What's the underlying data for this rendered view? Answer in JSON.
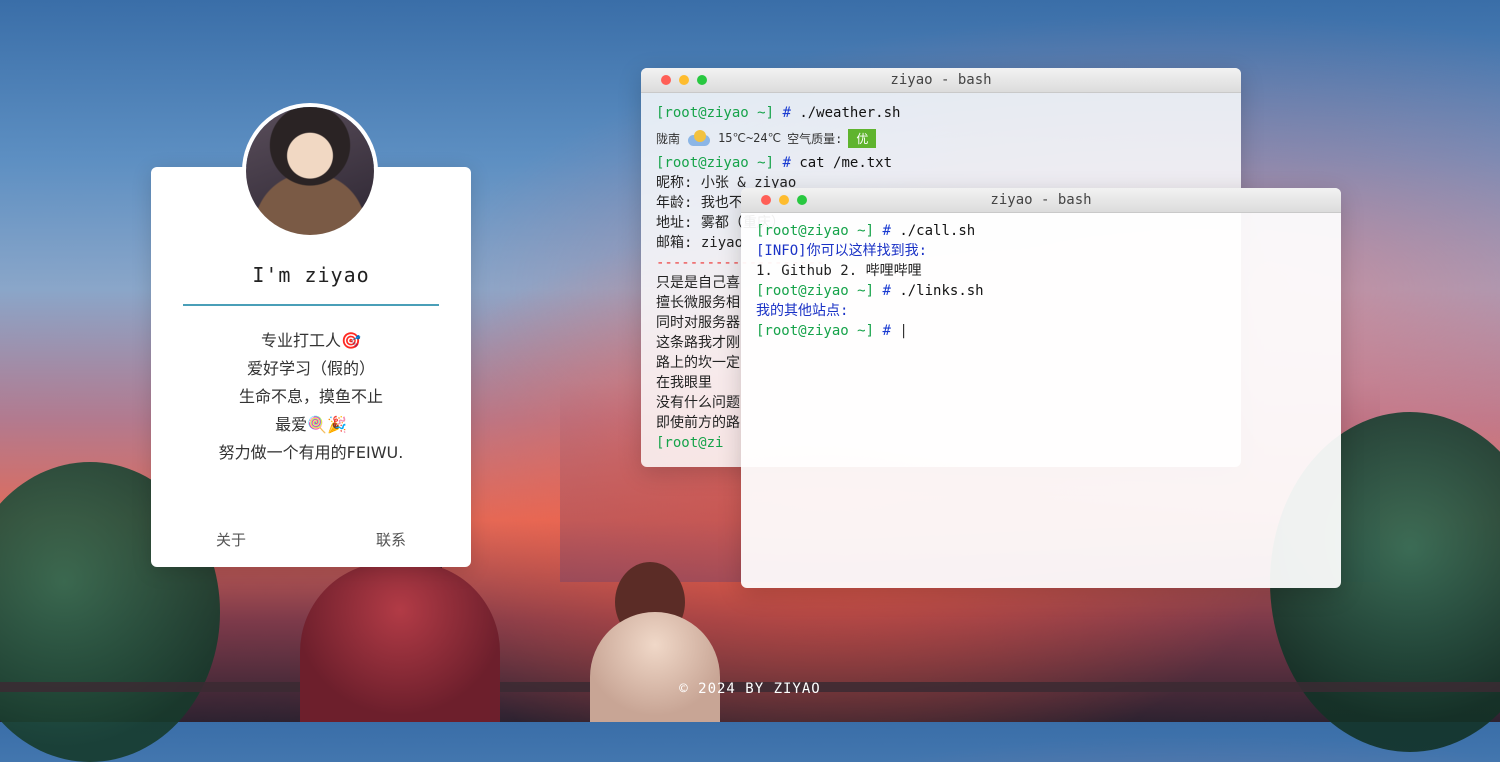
{
  "profile": {
    "name": "I'm ziyao",
    "lines": [
      "专业打工人🎯",
      "爱好学习（假的）",
      "生命不息，摸鱼不止",
      "最爱🍭🎉",
      "努力做一个有用的FEIWU."
    ],
    "nav": [
      "关于",
      "联系"
    ]
  },
  "terminal1": {
    "title": "ziyao - bash",
    "prompt": "[root@ziyao ~]",
    "hash": "#",
    "cmd_weather": "./weather.sh",
    "weather": {
      "city": "陇南",
      "temp": "15℃~24℃",
      "aqi_label": "空气质量:",
      "aqi_value": "优"
    },
    "cmd_me": "cat /me.txt",
    "me_lines": [
      "昵称: 小张 & ziyao",
      "年龄: 我也不",
      "地址: 雾都（重庆）",
      "邮箱: ziyao"
    ],
    "separator": "--------------------",
    "story_lines": [
      "只是是自己喜",
      "擅长微服务相",
      "同时对服务器",
      "这条路我才刚",
      "路上的坎一定",
      "在我眼里",
      "没有什么问题",
      "即使前方的路"
    ],
    "last_prompt": "[root@zi"
  },
  "terminal2": {
    "title": "ziyao - bash",
    "prompt": "[root@ziyao ~]",
    "hash": "#",
    "cmd_call": "./call.sh",
    "info": "[INFO]你可以这样找到我:",
    "call_list": "1. Github 2. 哔哩哔哩",
    "cmd_links": "./links.sh",
    "links_label": "我的其他站点:",
    "cursor": "|"
  },
  "footer": "© 2024 BY ZIYAO"
}
